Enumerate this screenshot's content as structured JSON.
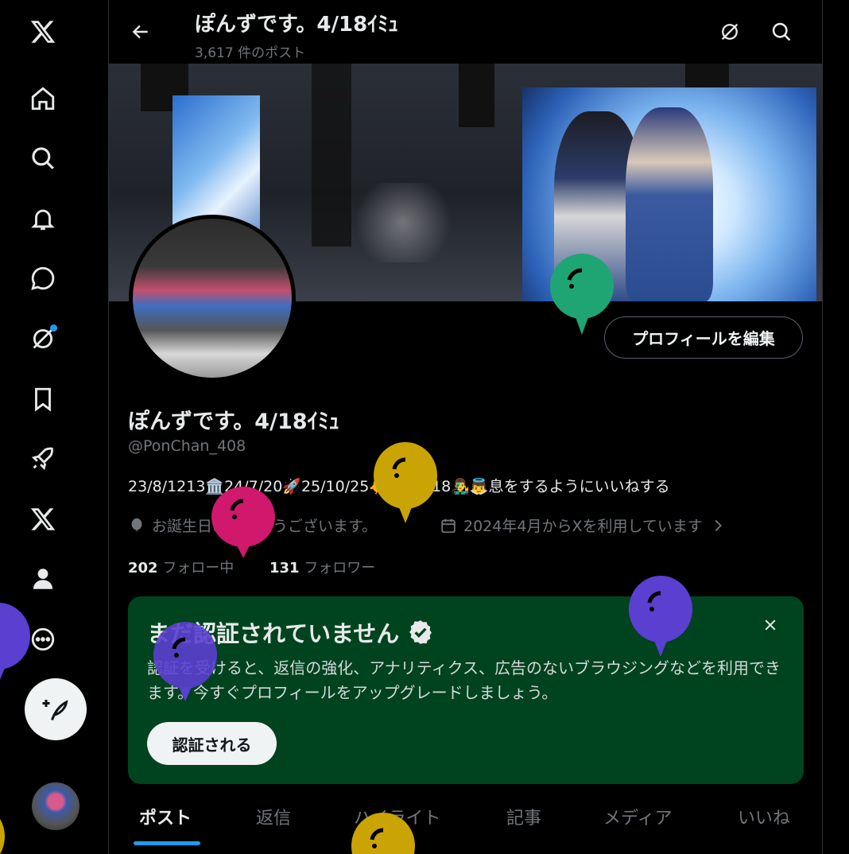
{
  "header": {
    "title": "ぽんずです。4/18ｲﾐｭ",
    "post_count": "3,617 件のポスト"
  },
  "sidebar": {
    "items": [
      {
        "icon": "x-logo-icon"
      },
      {
        "icon": "home-icon"
      },
      {
        "icon": "search-icon"
      },
      {
        "icon": "bell-icon"
      },
      {
        "icon": "chat-icon"
      },
      {
        "icon": "grok-icon",
        "badge": true
      },
      {
        "icon": "bookmark-icon"
      },
      {
        "icon": "rocket-icon"
      },
      {
        "icon": "x-premium-icon"
      },
      {
        "icon": "profile-icon"
      },
      {
        "icon": "more-icon"
      }
    ],
    "post_button_icon": "compose-icon"
  },
  "profile": {
    "edit_label": "プロフィールを編集",
    "name": "ぽんずです。4/18ｲﾐｭ",
    "handle": "@PonChan_408",
    "bio": "23/8/1213🏛️24/7/20🚀25/10/25🐥 26/4/18👨‍🎤👼息をするようにいいねする",
    "birthday": "お誕生日おめでとうございます。",
    "joined": "2024年4月からXを利用しています",
    "following_count": "202",
    "following_label": "フォロー中",
    "followers_count": "131",
    "followers_label": "フォロワー"
  },
  "verify_card": {
    "title": "まだ認証されていません",
    "text": "認証を受けると、返信の強化、アナリティクス、広告のないブラウジングなどを利用できます。今すぐプロフィールをアップグレードしましょう。",
    "button": "認証される"
  },
  "tabs": [
    {
      "label": "ポスト",
      "active": true
    },
    {
      "label": "返信"
    },
    {
      "label": "ハイライト"
    },
    {
      "label": "記事"
    },
    {
      "label": "メディア"
    },
    {
      "label": "いいね"
    }
  ],
  "colors": {
    "accent": "#1d9bf0",
    "card_bg": "#00431f",
    "muted": "#71767b",
    "balloon_green": "#1fa574",
    "balloon_magenta": "#d0186c",
    "balloon_yellow": "#c9a404",
    "balloon_purple": "#5b3fd0"
  }
}
